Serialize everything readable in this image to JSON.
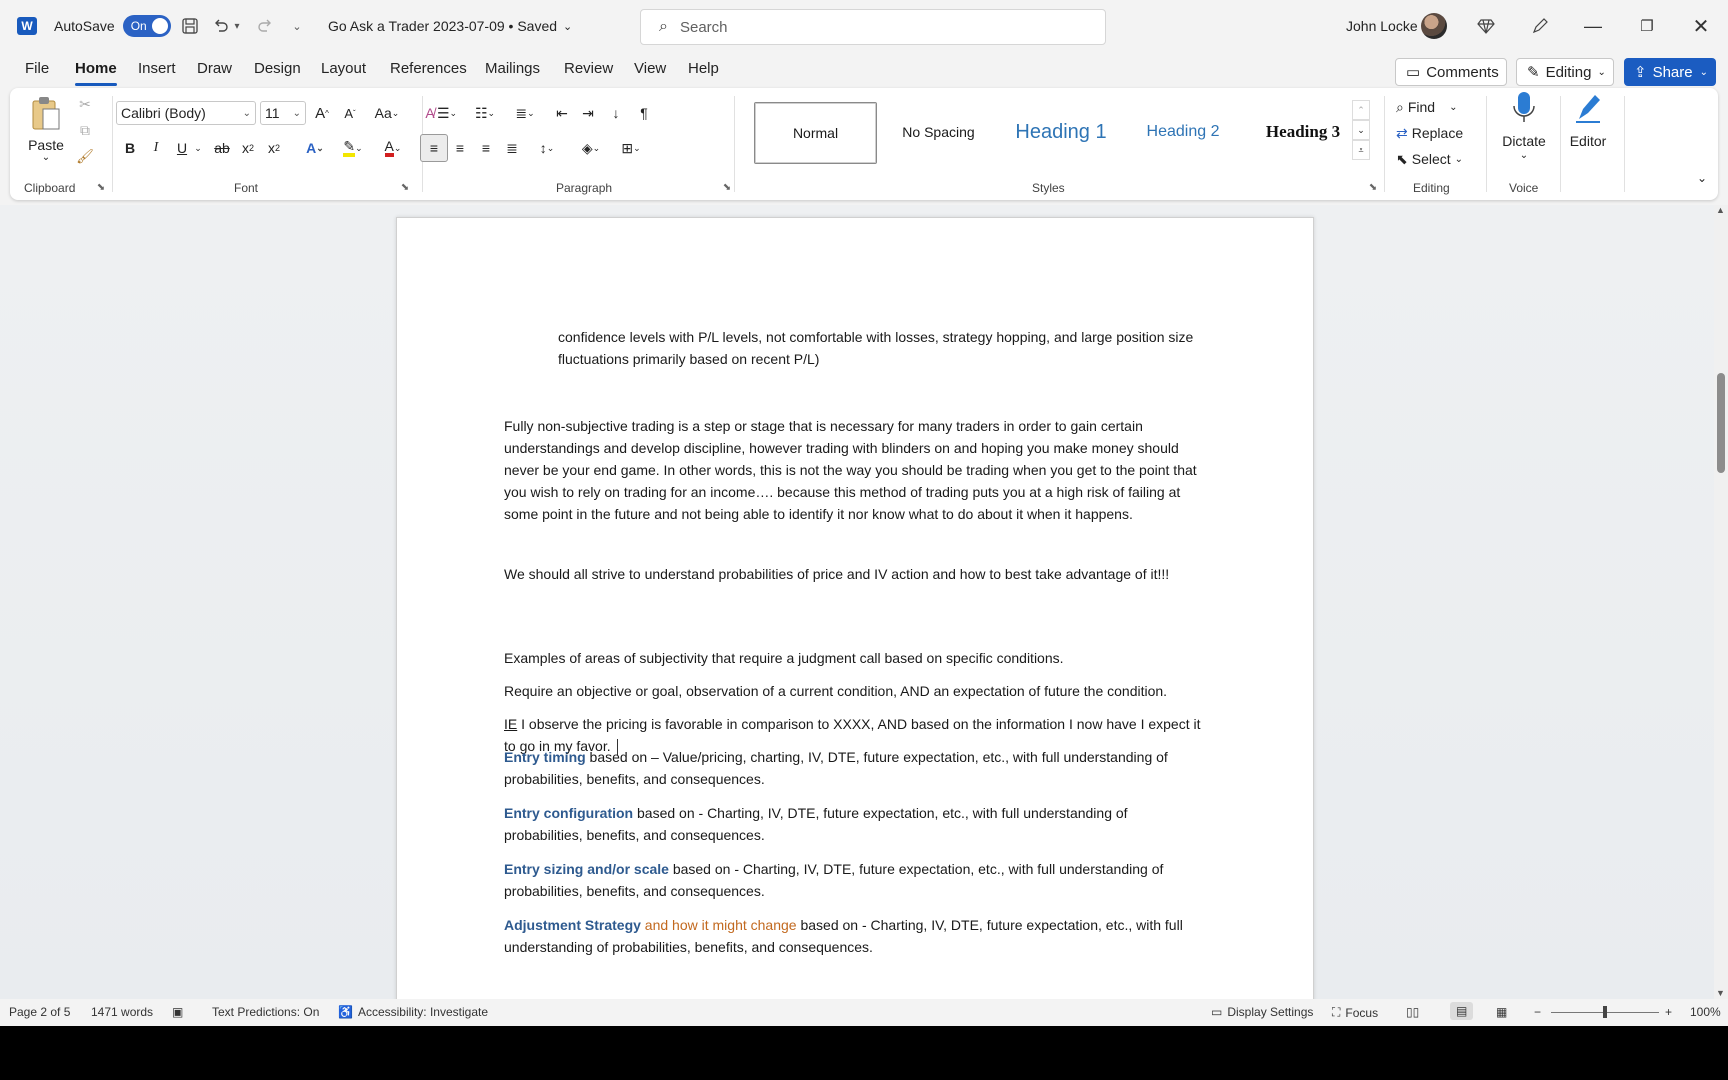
{
  "titlebar": {
    "app_icon": "word-logo",
    "autosave_label": "AutoSave",
    "autosave_state": "On",
    "doc_title": "Go Ask a Trader 2023-07-09 • Saved",
    "search_placeholder": "Search",
    "user_name": "John Locke"
  },
  "tabs": [
    "File",
    "Home",
    "Insert",
    "Draw",
    "Design",
    "Layout",
    "References",
    "Mailings",
    "Review",
    "View",
    "Help"
  ],
  "actions": {
    "comments": "Comments",
    "editing": "Editing",
    "share": "Share"
  },
  "ribbon": {
    "clipboard": {
      "paste": "Paste",
      "label": "Clipboard"
    },
    "font": {
      "name": "Calibri (Body)",
      "size": "11",
      "label": "Font"
    },
    "paragraph": {
      "label": "Paragraph"
    },
    "styles": {
      "label": "Styles",
      "items": [
        "Normal",
        "No Spacing",
        "Heading 1",
        "Heading 2",
        "Heading 3"
      ]
    },
    "editing": {
      "find": "Find",
      "replace": "Replace",
      "select": "Select",
      "label": "Editing"
    },
    "voice": {
      "dictate": "Dictate",
      "label": "Voice"
    },
    "editor": {
      "label": "Editor"
    }
  },
  "document": {
    "p1": "confidence levels with P/L levels, not comfortable with losses, strategy hopping, and large position size fluctuations primarily based on recent P/L)",
    "p2": "Fully non-subjective trading is a step or stage that is necessary for many traders in order to gain certain understandings and develop discipline, however trading with blinders on and hoping you make money should never be your end game.  In other words, this is not the way you should be trading when you get to the point that you wish to rely on trading for an income…. because this method of trading puts you at a high risk of failing at some point in the future and not being able to identify it nor know what to do about it when it happens.",
    "p3": "We should all strive to understand probabilities of price and IV action and how to best take advantage of it!!!",
    "p4": " Examples of areas of subjectivity that require a judgment call based on specific conditions.",
    "p5": "Require an objective or goal, observation of a current condition, AND an expectation of future the condition.",
    "p6_ie": "IE",
    "p6_rest": " I observe the pricing is favorable in comparison to XXXX, AND based on the information I now have I expect it to go in my favor. ",
    "p7_head": "Entry timing",
    "p7_rest": " based on – Value/pricing, charting, IV, DTE, future expectation, etc., with full understanding of probabilities, benefits, and consequences.",
    "p8_head": "Entry configuration",
    "p8_rest": " based on - Charting, IV, DTE, future expectation, etc., with full understanding of probabilities, benefits, and consequences.",
    "p9_head": "Entry sizing and/or scale",
    "p9_rest": " based on - Charting, IV, DTE, future expectation, etc., with full understanding of probabilities, benefits, and consequences.",
    "p10_head": "Adjustment Strategy",
    "p10_mid": " and how it might change",
    "p10_rest": " based on - Charting, IV, DTE, future expectation, etc., with full understanding of probabilities, benefits, and consequences."
  },
  "statusbar": {
    "page": "Page 2 of 5",
    "words": "1471 words",
    "text_predictions": "Text Predictions: On",
    "accessibility": "Accessibility: Investigate",
    "display_settings": "Display Settings",
    "focus": "Focus",
    "zoom": "100%"
  },
  "colors": {
    "accent": "#185abd",
    "heading_blue": "#2e5a8f",
    "heading_orange": "#c2691f"
  }
}
